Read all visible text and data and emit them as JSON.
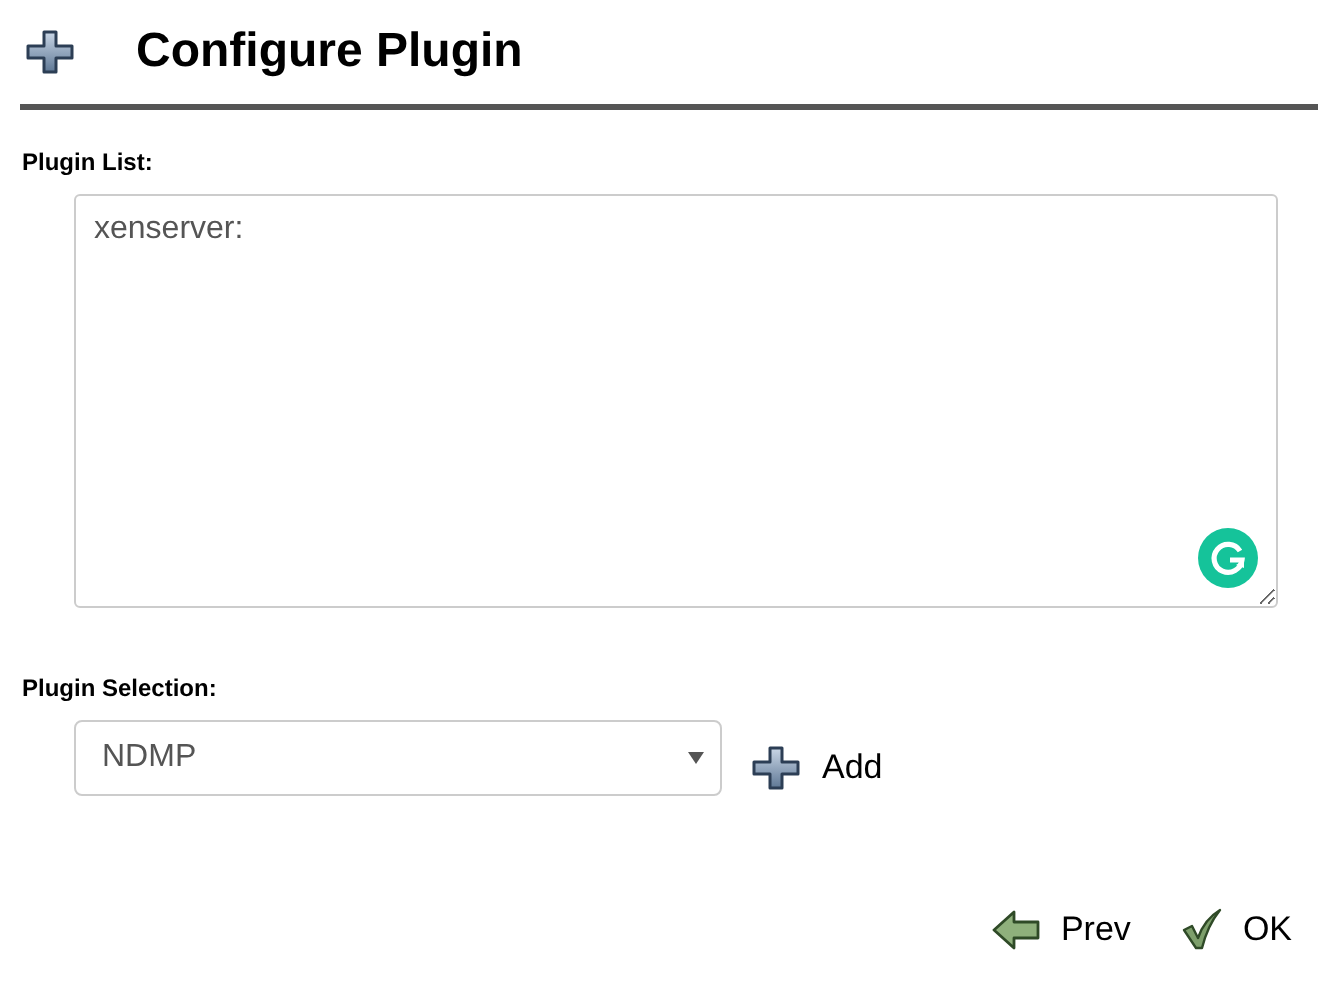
{
  "header": {
    "title": "Configure Plugin"
  },
  "plugin_list": {
    "label": "Plugin List:",
    "value": "xenserver:"
  },
  "plugin_selection": {
    "label": "Plugin Selection:",
    "value": "NDMP",
    "add_label": "Add"
  },
  "buttons": [
    {
      "kind": "prev",
      "label": "Prev"
    },
    {
      "kind": "ok",
      "label": "OK"
    }
  ]
}
